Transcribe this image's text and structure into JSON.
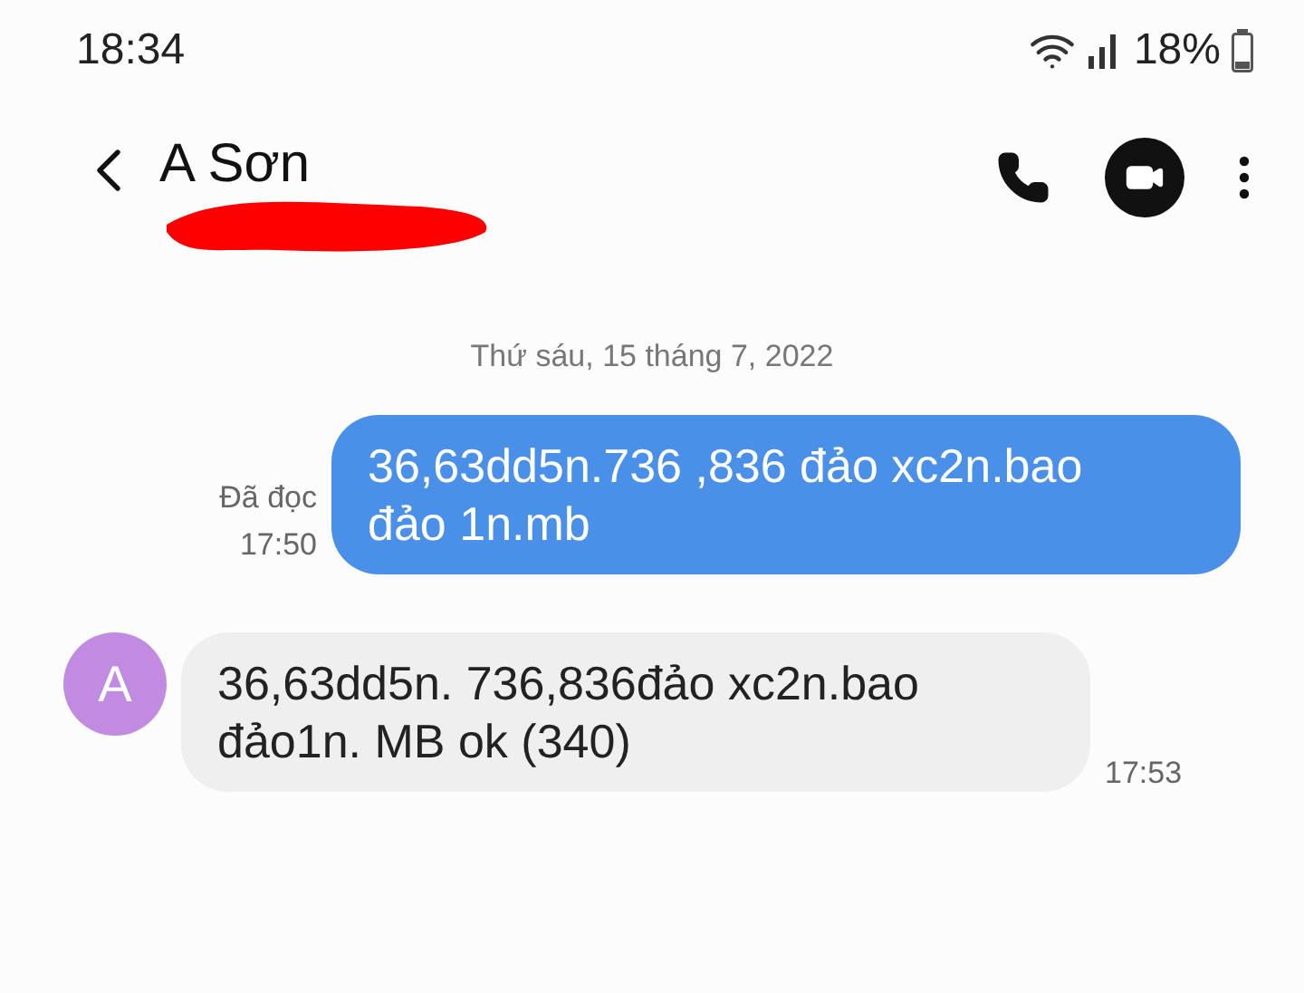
{
  "status_bar": {
    "time": "18:34",
    "battery": "18%"
  },
  "header": {
    "contact_name": "A Sơn"
  },
  "date_divider": "Thứ sáu, 15 tháng 7, 2022",
  "messages": [
    {
      "kind": "sent",
      "text": "36,63dd5n.736 ,836 đảo xc2n.bao đảo 1n.mb",
      "status": "Đã đọc",
      "time": "17:50"
    },
    {
      "kind": "received",
      "avatar": "A",
      "text": "36,63dd5n. 736,836đảo xc2n.bao đảo1n. MB ok (340)",
      "time": "17:53"
    }
  ]
}
